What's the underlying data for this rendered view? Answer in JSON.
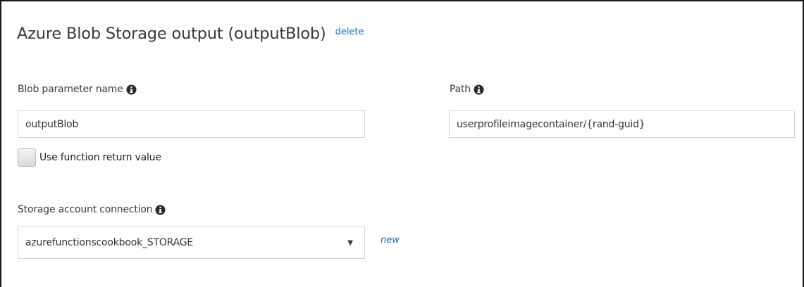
{
  "panel": {
    "title": "Azure Blob Storage output (outputBlob)",
    "delete_label": "delete"
  },
  "fields": {
    "blob_parameter_name": {
      "label": "Blob parameter name",
      "value": "outputBlob"
    },
    "path": {
      "label": "Path",
      "value": "userprofileimagecontainer/{rand-guid}"
    },
    "use_function_return_value": {
      "label": "Use function return value",
      "checked": false
    },
    "storage_account_connection": {
      "label": "Storage account connection",
      "selected": "azurefunctionscookbook_STORAGE",
      "new_label": "new"
    }
  },
  "icons": {
    "info": "info-icon",
    "dropdown": "chevron-down-icon"
  },
  "colors": {
    "link": "#1e6fb8",
    "text": "#3a3a3a",
    "border": "#d4d4d4"
  }
}
